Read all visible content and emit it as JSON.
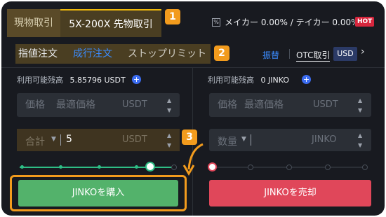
{
  "tabs": {
    "spot": "現物取引",
    "futures": "5X-200X 先物取引"
  },
  "fees": {
    "checkbox": "%",
    "text": "メイカー 0.00% / テイカー 0.00%",
    "hot": "HOT"
  },
  "callouts": [
    "1",
    "2",
    "3"
  ],
  "order_types": {
    "limit": "指値注文",
    "market": "成行注文",
    "stop": "ストップリミット"
  },
  "right_links": {
    "transfer": "振替",
    "otc": "OTC取引",
    "currency": "USD",
    "chevron": "›"
  },
  "buy": {
    "available_label": "利用可能残高",
    "available_value": "5.85796 USDT",
    "price_label": "価格",
    "price_placeholder": "最適価格",
    "price_unit": "USDT",
    "total_label": "合計",
    "total_value": "5",
    "total_unit": "USDT",
    "button": "JINKOを購入",
    "slider_percent": 75
  },
  "sell": {
    "available_label": "利用可能残高",
    "available_value": "0 JINKO",
    "price_label": "価格",
    "price_placeholder": "最適価格",
    "price_unit": "USDT",
    "qty_label": "数量",
    "qty_unit": "JINKO",
    "button": "JINKOを売却",
    "slider_percent": 0
  },
  "colors": {
    "background": "#181a20",
    "accent": "#f0b90b",
    "callout": "#f29b1d",
    "buy": "#53b26b",
    "sell": "#e0475a",
    "link": "#3b8cff"
  }
}
